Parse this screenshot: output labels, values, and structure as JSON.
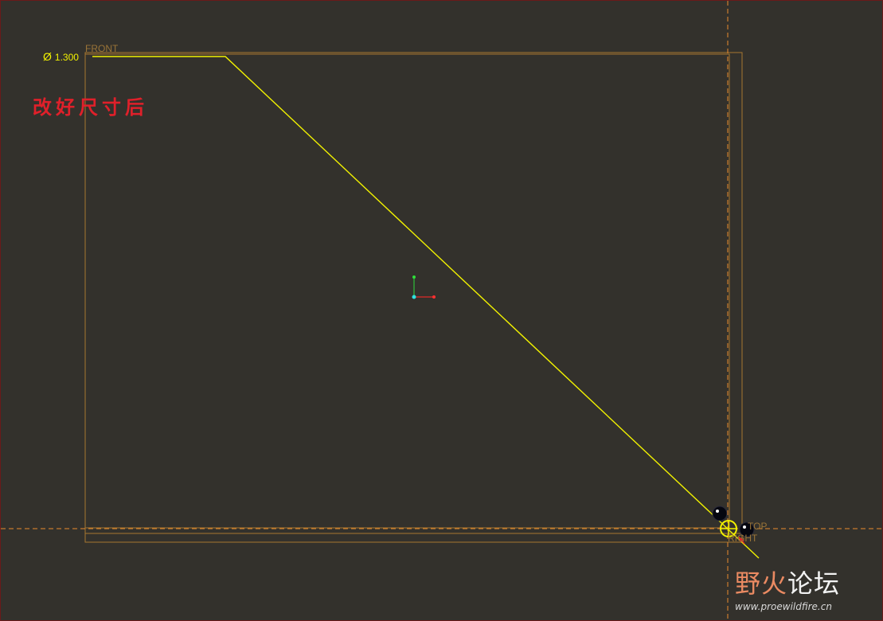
{
  "viewport": {
    "background": "#33312c",
    "border_color": "#6b1a1a"
  },
  "annotation": {
    "text": "改好尺寸后",
    "color": "#e0202a"
  },
  "dimension": {
    "symbol": "Ø",
    "value": "1.300",
    "color": "#f2f200"
  },
  "datum_planes": {
    "front_label": "FRONT",
    "top_label": "TOP",
    "right_label": "RIGHT",
    "color": "#9a7438",
    "dashed_color": "#e88a2e"
  },
  "sketch": {
    "line_color": "#f2f200",
    "icons": [
      "csys-icon",
      "sketch-point-icon",
      "sketch-origin-icon",
      "pick-arrow-icon"
    ]
  },
  "watermark": {
    "title_part1": "野火",
    "title_part2": "论坛",
    "url": "www.proewildfire.cn"
  }
}
